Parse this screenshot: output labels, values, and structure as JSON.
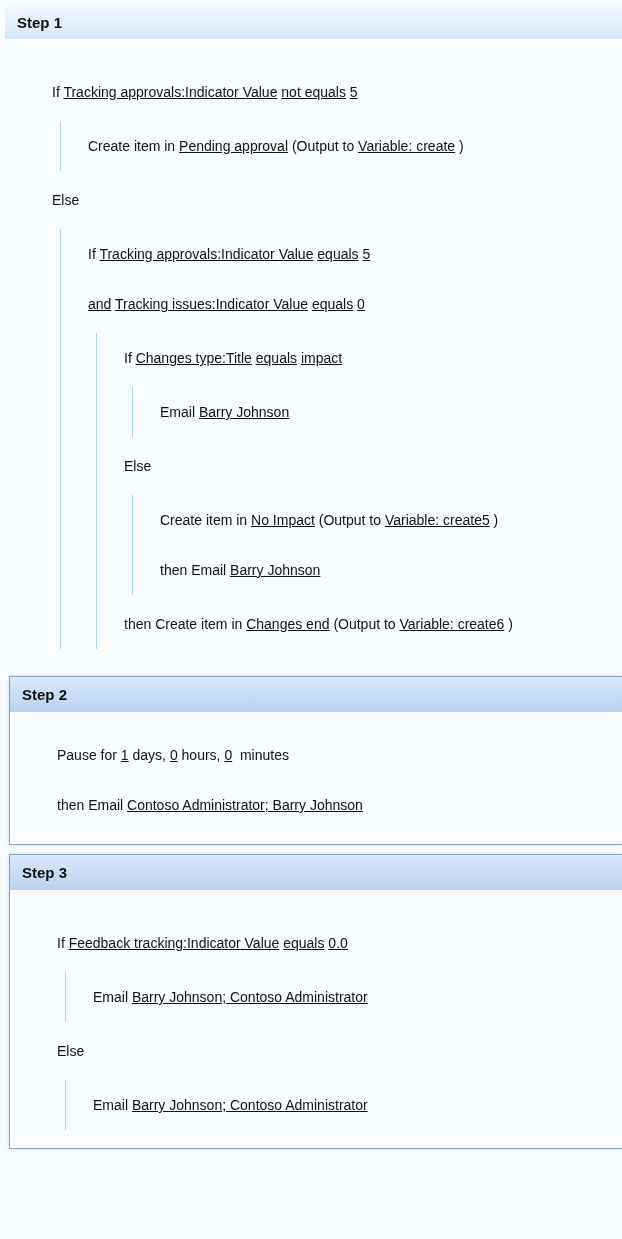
{
  "steps": [
    {
      "title": "Step 1",
      "bordered": false,
      "body": [
        {
          "kind": "condition",
          "parts": [
            {
              "text": "If"
            },
            {
              "link": "Tracking approvals:Indicator Value"
            },
            {
              "link": "not equals"
            },
            {
              "link": "5"
            }
          ]
        },
        {
          "kind": "block",
          "children": [
            {
              "kind": "action",
              "parts": [
                {
                  "text": "Create item in"
                },
                {
                  "link": "Pending approval"
                },
                {
                  "text": "(Output to"
                },
                {
                  "link": "Variable: create"
                },
                {
                  "text": ")"
                }
              ]
            }
          ]
        },
        {
          "kind": "else",
          "parts": [
            {
              "text": "Else"
            }
          ]
        },
        {
          "kind": "block",
          "children": [
            {
              "kind": "condition",
              "parts": [
                {
                  "text": "If"
                },
                {
                  "link": "Tracking approvals:Indicator Value"
                },
                {
                  "link": "equals"
                },
                {
                  "link": "5"
                }
              ]
            },
            {
              "kind": "condition",
              "parts": [
                {
                  "link": "and"
                },
                {
                  "link": "Tracking issues:Indicator Value"
                },
                {
                  "link": "equals"
                },
                {
                  "link": "0"
                }
              ]
            },
            {
              "kind": "block",
              "children": [
                {
                  "kind": "condition",
                  "parts": [
                    {
                      "text": "If"
                    },
                    {
                      "link": "Changes type:Title"
                    },
                    {
                      "link": "equals"
                    },
                    {
                      "link": "impact"
                    }
                  ]
                },
                {
                  "kind": "block",
                  "children": [
                    {
                      "kind": "action",
                      "parts": [
                        {
                          "text": "Email"
                        },
                        {
                          "link": "Barry Johnson"
                        }
                      ]
                    }
                  ]
                },
                {
                  "kind": "else",
                  "parts": [
                    {
                      "text": "Else"
                    }
                  ]
                },
                {
                  "kind": "block",
                  "children": [
                    {
                      "kind": "action",
                      "parts": [
                        {
                          "text": "Create item in"
                        },
                        {
                          "link": "No Impact"
                        },
                        {
                          "text": "(Output to"
                        },
                        {
                          "link": "Variable: create5"
                        },
                        {
                          "text": ")"
                        }
                      ]
                    },
                    {
                      "kind": "action",
                      "parts": [
                        {
                          "text": "then Email"
                        },
                        {
                          "link": "Barry Johnson"
                        }
                      ]
                    }
                  ]
                },
                {
                  "kind": "action",
                  "parts": [
                    {
                      "text": "then Create item in"
                    },
                    {
                      "link": "Changes end"
                    },
                    {
                      "text": "(Output to"
                    },
                    {
                      "link": "Variable: create6"
                    },
                    {
                      "text": ")"
                    }
                  ]
                }
              ]
            }
          ]
        }
      ]
    },
    {
      "title": "Step 2",
      "bordered": true,
      "body": [
        {
          "kind": "action",
          "parts": [
            {
              "text": "Pause for"
            },
            {
              "link": "1"
            },
            {
              "text": "days,"
            },
            {
              "link": "0"
            },
            {
              "text": "hours,"
            },
            {
              "link": "0"
            },
            {
              "text": " minutes"
            }
          ]
        },
        {
          "kind": "action",
          "parts": [
            {
              "text": "then Email"
            },
            {
              "link": "Contoso Administrator; Barry Johnson"
            }
          ]
        }
      ]
    },
    {
      "title": "Step 3",
      "bordered": true,
      "body": [
        {
          "kind": "condition",
          "parts": [
            {
              "text": "If"
            },
            {
              "link": "Feedback tracking:Indicator Value"
            },
            {
              "link": "equals"
            },
            {
              "link": "0.0"
            }
          ]
        },
        {
          "kind": "block",
          "children": [
            {
              "kind": "action",
              "parts": [
                {
                  "text": "Email"
                },
                {
                  "link": "Barry Johnson; Contoso Administrator"
                }
              ]
            }
          ]
        },
        {
          "kind": "else",
          "parts": [
            {
              "text": "Else"
            }
          ]
        },
        {
          "kind": "block",
          "children": [
            {
              "kind": "action",
              "parts": [
                {
                  "text": "Email"
                },
                {
                  "link": "Barry Johnson; Contoso Administrator"
                }
              ]
            }
          ]
        }
      ]
    }
  ]
}
